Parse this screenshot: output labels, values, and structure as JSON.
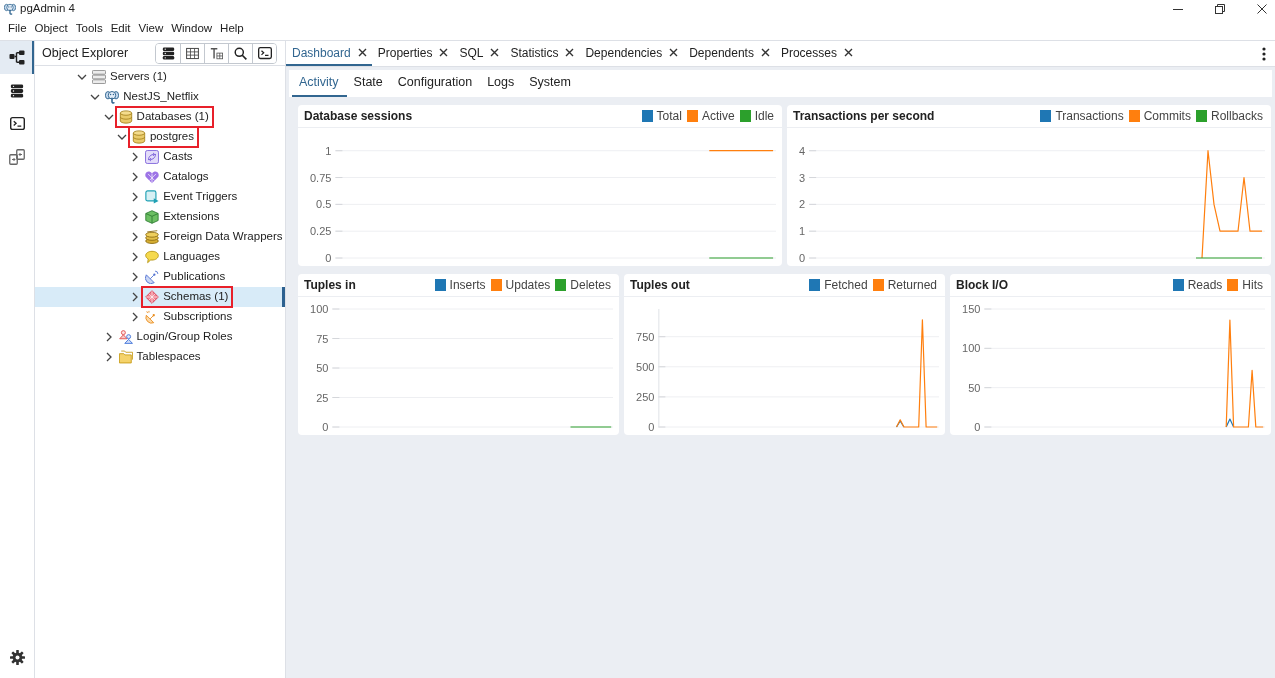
{
  "window": {
    "title": "pgAdmin 4"
  },
  "menu": [
    "File",
    "Object",
    "Tools",
    "Edit",
    "View",
    "Window",
    "Help"
  ],
  "activity_bar": [
    {
      "kind": "explorer",
      "selected": true
    },
    {
      "kind": "database",
      "selected": false
    },
    {
      "kind": "terminal",
      "selected": false
    },
    {
      "kind": "compare",
      "selected": false
    }
  ],
  "object_explorer": {
    "title": "Object Explorer",
    "tree": [
      {
        "label": "Servers (1)",
        "kind": "servers",
        "expanded": true,
        "selected": false,
        "outlined": false,
        "children": [
          {
            "label": "NestJS_Netflix",
            "kind": "server",
            "expanded": true,
            "selected": false,
            "outlined": false,
            "children": [
              {
                "label": "Databases (1)",
                "kind": "databases",
                "expanded": true,
                "selected": false,
                "outlined": true,
                "children": [
                  {
                    "label": "postgres",
                    "kind": "database",
                    "expanded": true,
                    "selected": false,
                    "outlined": true,
                    "children": [
                      {
                        "label": "Casts",
                        "kind": "casts",
                        "expanded": false,
                        "selected": false,
                        "outlined": false
                      },
                      {
                        "label": "Catalogs",
                        "kind": "catalogs",
                        "expanded": false,
                        "selected": false,
                        "outlined": false
                      },
                      {
                        "label": "Event Triggers",
                        "kind": "triggers",
                        "expanded": false,
                        "selected": false,
                        "outlined": false
                      },
                      {
                        "label": "Extensions",
                        "kind": "extensions",
                        "expanded": false,
                        "selected": false,
                        "outlined": false
                      },
                      {
                        "label": "Foreign Data Wrappers",
                        "kind": "wrappers",
                        "expanded": false,
                        "selected": false,
                        "outlined": false
                      },
                      {
                        "label": "Languages",
                        "kind": "languages",
                        "expanded": false,
                        "selected": false,
                        "outlined": false
                      },
                      {
                        "label": "Publications",
                        "kind": "publications",
                        "expanded": false,
                        "selected": false,
                        "outlined": false
                      },
                      {
                        "label": "Schemas (1)",
                        "kind": "schemas",
                        "expanded": false,
                        "selected": true,
                        "outlined": true
                      },
                      {
                        "label": "Subscriptions",
                        "kind": "subscriptions",
                        "expanded": false,
                        "selected": false,
                        "outlined": false
                      }
                    ]
                  }
                ]
              },
              {
                "label": "Login/Group Roles",
                "kind": "roles",
                "expanded": false,
                "selected": false,
                "outlined": false
              },
              {
                "label": "Tablespaces",
                "kind": "tablespaces",
                "expanded": false,
                "selected": false,
                "outlined": false
              }
            ]
          }
        ]
      }
    ]
  },
  "tabs": [
    {
      "label": "Dashboard",
      "selected": true
    },
    {
      "label": "Properties",
      "selected": false
    },
    {
      "label": "SQL",
      "selected": false
    },
    {
      "label": "Statistics",
      "selected": false
    },
    {
      "label": "Dependencies",
      "selected": false
    },
    {
      "label": "Dependents",
      "selected": false
    },
    {
      "label": "Processes",
      "selected": false
    }
  ],
  "subtabs": [
    {
      "label": "Activity",
      "selected": true
    },
    {
      "label": "State",
      "selected": false
    },
    {
      "label": "Configuration",
      "selected": false
    },
    {
      "label": "Logs",
      "selected": false
    },
    {
      "label": "System",
      "selected": false
    }
  ],
  "panel_rows": [
    [
      {
        "title": "Database sessions",
        "chart_data": {
          "type": "line",
          "grid": true,
          "categories": [
            null,
            null,
            null,
            null,
            null,
            null,
            null,
            null,
            null,
            null,
            null,
            null,
            null,
            null,
            null,
            null,
            null,
            null,
            null,
            null,
            null,
            null,
            null,
            null,
            null,
            null,
            null,
            null,
            null,
            null,
            null,
            null,
            null,
            null,
            null,
            null,
            null,
            null,
            null,
            null,
            null,
            null,
            null,
            null,
            null,
            null,
            null,
            null,
            null,
            null,
            null,
            null,
            null,
            null,
            null,
            null,
            null,
            null,
            null,
            null,
            null,
            null,
            null,
            null,
            null,
            null,
            null,
            null,
            null,
            null,
            null,
            null,
            null,
            null,
            null,
            null
          ],
          "ylim": [
            0,
            1
          ],
          "yticks": [
            0,
            0.25,
            0.5,
            0.75,
            1
          ],
          "series": [
            {
              "name": "Total",
              "color": "#1f77b4",
              "values": [
                null,
                null,
                null,
                null,
                null,
                null,
                null,
                null,
                null,
                null,
                null,
                null,
                null,
                null,
                null,
                null,
                null,
                null,
                null,
                null,
                null,
                null,
                null,
                null,
                null,
                null,
                null,
                null,
                null,
                null,
                null,
                null,
                null,
                null,
                null,
                null,
                null,
                null,
                null,
                null,
                null,
                null,
                null,
                null,
                null,
                null,
                null,
                null,
                null,
                null,
                null,
                null,
                null,
                null,
                null,
                null,
                null,
                null,
                null,
                null,
                null,
                null,
                null,
                null,
                null,
                null,
                null,
                null,
                null,
                null,
                null,
                null,
                null,
                null,
                null,
                null
              ]
            },
            {
              "name": "Active",
              "color": "#ff7f0e",
              "values": [
                null,
                null,
                null,
                null,
                null,
                null,
                null,
                null,
                null,
                null,
                null,
                null,
                null,
                null,
                null,
                null,
                null,
                null,
                null,
                null,
                null,
                null,
                null,
                null,
                null,
                null,
                null,
                null,
                null,
                null,
                null,
                null,
                null,
                null,
                null,
                null,
                null,
                null,
                null,
                null,
                null,
                null,
                null,
                null,
                null,
                null,
                null,
                null,
                null,
                null,
                null,
                null,
                null,
                null,
                null,
                null,
                null,
                null,
                null,
                null,
                null,
                null,
                null,
                null,
                1,
                1,
                1,
                1,
                1,
                1,
                1,
                1,
                1,
                1,
                1,
                1
              ]
            },
            {
              "name": "Idle",
              "color": "#2ca02c",
              "values": [
                null,
                null,
                null,
                null,
                null,
                null,
                null,
                null,
                null,
                null,
                null,
                null,
                null,
                null,
                null,
                null,
                null,
                null,
                null,
                null,
                null,
                null,
                null,
                null,
                null,
                null,
                null,
                null,
                null,
                null,
                null,
                null,
                null,
                null,
                null,
                null,
                null,
                null,
                null,
                null,
                null,
                null,
                null,
                null,
                null,
                null,
                null,
                null,
                null,
                null,
                null,
                null,
                null,
                null,
                null,
                null,
                null,
                null,
                null,
                null,
                null,
                null,
                null,
                null,
                0,
                0,
                0,
                0,
                0,
                0,
                0,
                0,
                0,
                0,
                0,
                0
              ]
            }
          ]
        }
      },
      {
        "title": "Transactions per second",
        "chart_data": {
          "type": "line",
          "grid": true,
          "categories": [
            null,
            null,
            null,
            null,
            null,
            null,
            null,
            null,
            null,
            null,
            null,
            null,
            null,
            null,
            null,
            null,
            null,
            null,
            null,
            null,
            null,
            null,
            null,
            null,
            null,
            null,
            null,
            null,
            null,
            null,
            null,
            null,
            null,
            null,
            null,
            null,
            null,
            null,
            null,
            null,
            null,
            null,
            null,
            null,
            null,
            null,
            null,
            null,
            null,
            null,
            null,
            null,
            null,
            null,
            null,
            null,
            null,
            null,
            null,
            null,
            null,
            null,
            null,
            null,
            null,
            null,
            null,
            null,
            null,
            null,
            null,
            null,
            null,
            null,
            null,
            null
          ],
          "ylim": [
            0,
            4
          ],
          "yticks": [
            0,
            1,
            2,
            3,
            4
          ],
          "series": [
            {
              "name": "Transactions",
              "color": "#1f77b4",
              "values": [
                null,
                null,
                null,
                null,
                null,
                null,
                null,
                null,
                null,
                null,
                null,
                null,
                null,
                null,
                null,
                null,
                null,
                null,
                null,
                null,
                null,
                null,
                null,
                null,
                null,
                null,
                null,
                null,
                null,
                null,
                null,
                null,
                null,
                null,
                null,
                null,
                null,
                null,
                null,
                null,
                null,
                null,
                null,
                null,
                null,
                null,
                null,
                null,
                null,
                null,
                null,
                null,
                null,
                null,
                null,
                null,
                null,
                null,
                null,
                null,
                null,
                null,
                null,
                null,
                null,
                null,
                null,
                null,
                null,
                null,
                null,
                null,
                null,
                null,
                null,
                null
              ]
            },
            {
              "name": "Commits",
              "color": "#ff7f0e",
              "values": [
                null,
                null,
                null,
                null,
                null,
                null,
                null,
                null,
                null,
                null,
                null,
                null,
                null,
                null,
                null,
                null,
                null,
                null,
                null,
                null,
                null,
                null,
                null,
                null,
                null,
                null,
                null,
                null,
                null,
                null,
                null,
                null,
                null,
                null,
                null,
                null,
                null,
                null,
                null,
                null,
                null,
                null,
                null,
                null,
                null,
                null,
                null,
                null,
                null,
                null,
                null,
                null,
                null,
                null,
                null,
                null,
                null,
                null,
                null,
                null,
                null,
                null,
                null,
                null,
                null,
                0,
                4,
                2,
                1,
                1,
                1,
                1,
                3,
                1,
                1,
                1
              ]
            },
            {
              "name": "Rollbacks",
              "color": "#2ca02c",
              "values": [
                null,
                null,
                null,
                null,
                null,
                null,
                null,
                null,
                null,
                null,
                null,
                null,
                null,
                null,
                null,
                null,
                null,
                null,
                null,
                null,
                null,
                null,
                null,
                null,
                null,
                null,
                null,
                null,
                null,
                null,
                null,
                null,
                null,
                null,
                null,
                null,
                null,
                null,
                null,
                null,
                null,
                null,
                null,
                null,
                null,
                null,
                null,
                null,
                null,
                null,
                null,
                null,
                null,
                null,
                null,
                null,
                null,
                null,
                null,
                null,
                null,
                null,
                null,
                null,
                0,
                0,
                0,
                0,
                0,
                0,
                0,
                0,
                0,
                0,
                0,
                0
              ]
            }
          ]
        }
      }
    ],
    [
      {
        "title": "Tuples in",
        "chart_data": {
          "type": "line",
          "grid": true,
          "categories": [
            null,
            null,
            null,
            null,
            null,
            null,
            null,
            null,
            null,
            null,
            null,
            null,
            null,
            null,
            null,
            null,
            null,
            null,
            null,
            null,
            null,
            null,
            null,
            null,
            null,
            null,
            null,
            null,
            null,
            null,
            null,
            null,
            null,
            null,
            null,
            null,
            null,
            null,
            null,
            null,
            null,
            null,
            null,
            null,
            null,
            null,
            null,
            null,
            null,
            null,
            null,
            null,
            null,
            null,
            null,
            null,
            null,
            null,
            null,
            null,
            null,
            null,
            null,
            null,
            null,
            null,
            null,
            null,
            null,
            null,
            null,
            null,
            null,
            null,
            null,
            null
          ],
          "ylim": [
            0,
            100
          ],
          "yticks": [
            0,
            25,
            50,
            75,
            100
          ],
          "series": [
            {
              "name": "Inserts",
              "color": "#1f77b4",
              "values": [
                null,
                null,
                null,
                null,
                null,
                null,
                null,
                null,
                null,
                null,
                null,
                null,
                null,
                null,
                null,
                null,
                null,
                null,
                null,
                null,
                null,
                null,
                null,
                null,
                null,
                null,
                null,
                null,
                null,
                null,
                null,
                null,
                null,
                null,
                null,
                null,
                null,
                null,
                null,
                null,
                null,
                null,
                null,
                null,
                null,
                null,
                null,
                null,
                null,
                null,
                null,
                null,
                null,
                null,
                null,
                null,
                null,
                null,
                null,
                null,
                null,
                null,
                null,
                null,
                null,
                null,
                null,
                null,
                null,
                null,
                null,
                null,
                null,
                null,
                null,
                null
              ]
            },
            {
              "name": "Updates",
              "color": "#ff7f0e",
              "values": [
                null,
                null,
                null,
                null,
                null,
                null,
                null,
                null,
                null,
                null,
                null,
                null,
                null,
                null,
                null,
                null,
                null,
                null,
                null,
                null,
                null,
                null,
                null,
                null,
                null,
                null,
                null,
                null,
                null,
                null,
                null,
                null,
                null,
                null,
                null,
                null,
                null,
                null,
                null,
                null,
                null,
                null,
                null,
                null,
                null,
                null,
                null,
                null,
                null,
                null,
                null,
                null,
                null,
                null,
                null,
                null,
                null,
                null,
                null,
                null,
                null,
                null,
                null,
                null,
                null,
                null,
                null,
                null,
                null,
                null,
                null,
                null,
                null,
                null,
                null,
                null
              ]
            },
            {
              "name": "Deletes",
              "color": "#2ca02c",
              "values": [
                null,
                null,
                null,
                null,
                null,
                null,
                null,
                null,
                null,
                null,
                null,
                null,
                null,
                null,
                null,
                null,
                null,
                null,
                null,
                null,
                null,
                null,
                null,
                null,
                null,
                null,
                null,
                null,
                null,
                null,
                null,
                null,
                null,
                null,
                null,
                null,
                null,
                null,
                null,
                null,
                null,
                null,
                null,
                null,
                null,
                null,
                null,
                null,
                null,
                null,
                null,
                null,
                null,
                null,
                null,
                null,
                null,
                null,
                null,
                null,
                null,
                null,
                null,
                null,
                0,
                0,
                0,
                0,
                0,
                0,
                0,
                0,
                0,
                0,
                0,
                0
              ]
            }
          ]
        }
      },
      {
        "title": "Tuples out",
        "chart_data": {
          "type": "line",
          "grid": true,
          "categories": [
            null,
            null,
            null,
            null,
            null,
            null,
            null,
            null,
            null,
            null,
            null,
            null,
            null,
            null,
            null,
            null,
            null,
            null,
            null,
            null,
            null,
            null,
            null,
            null,
            null,
            null,
            null,
            null,
            null,
            null,
            null,
            null,
            null,
            null,
            null,
            null,
            null,
            null,
            null,
            null,
            null,
            null,
            null,
            null,
            null,
            null,
            null,
            null,
            null,
            null,
            null,
            null,
            null,
            null,
            null,
            null,
            null,
            null,
            null,
            null,
            null,
            null,
            null,
            null,
            null,
            null,
            null,
            null,
            null,
            null,
            null,
            null,
            null,
            null,
            null,
            null
          ],
          "ylim": [
            0,
            980
          ],
          "yticks": [
            0,
            250,
            500,
            750
          ],
          "series": [
            {
              "name": "Fetched",
              "color": "#1f77b4",
              "values": [
                null,
                null,
                null,
                null,
                null,
                null,
                null,
                null,
                null,
                null,
                null,
                null,
                null,
                null,
                null,
                null,
                null,
                null,
                null,
                null,
                null,
                null,
                null,
                null,
                null,
                null,
                null,
                null,
                null,
                null,
                null,
                null,
                null,
                null,
                null,
                null,
                null,
                null,
                null,
                null,
                null,
                null,
                null,
                null,
                null,
                null,
                null,
                null,
                null,
                null,
                null,
                null,
                null,
                null,
                null,
                null,
                null,
                null,
                null,
                null,
                null,
                null,
                null,
                null,
                0,
                50,
                0,
                null,
                null,
                null,
                null,
                null,
                null,
                null,
                null,
                null
              ]
            },
            {
              "name": "Returned",
              "color": "#ff7f0e",
              "values": [
                null,
                null,
                null,
                null,
                null,
                null,
                null,
                null,
                null,
                null,
                null,
                null,
                null,
                null,
                null,
                null,
                null,
                null,
                null,
                null,
                null,
                null,
                null,
                null,
                null,
                null,
                null,
                null,
                null,
                null,
                null,
                null,
                null,
                null,
                null,
                null,
                null,
                null,
                null,
                null,
                null,
                null,
                null,
                null,
                null,
                null,
                null,
                null,
                null,
                null,
                null,
                null,
                null,
                null,
                null,
                null,
                null,
                null,
                null,
                null,
                null,
                null,
                null,
                null,
                0,
                60,
                0,
                0,
                0,
                0,
                0,
                890,
                0,
                0,
                0,
                0
              ]
            }
          ]
        }
      },
      {
        "title": "Block I/O",
        "chart_data": {
          "type": "line",
          "grid": true,
          "categories": [
            null,
            null,
            null,
            null,
            null,
            null,
            null,
            null,
            null,
            null,
            null,
            null,
            null,
            null,
            null,
            null,
            null,
            null,
            null,
            null,
            null,
            null,
            null,
            null,
            null,
            null,
            null,
            null,
            null,
            null,
            null,
            null,
            null,
            null,
            null,
            null,
            null,
            null,
            null,
            null,
            null,
            null,
            null,
            null,
            null,
            null,
            null,
            null,
            null,
            null,
            null,
            null,
            null,
            null,
            null,
            null,
            null,
            null,
            null,
            null,
            null,
            null,
            null,
            null,
            null,
            null,
            null,
            null,
            null,
            null,
            null,
            null,
            null,
            null,
            null,
            null
          ],
          "ylim": [
            0,
            150
          ],
          "yticks": [
            0,
            50,
            100,
            150
          ],
          "series": [
            {
              "name": "Reads",
              "color": "#1f77b4",
              "values": [
                null,
                null,
                null,
                null,
                null,
                null,
                null,
                null,
                null,
                null,
                null,
                null,
                null,
                null,
                null,
                null,
                null,
                null,
                null,
                null,
                null,
                null,
                null,
                null,
                null,
                null,
                null,
                null,
                null,
                null,
                null,
                null,
                null,
                null,
                null,
                null,
                null,
                null,
                null,
                null,
                null,
                null,
                null,
                null,
                null,
                null,
                null,
                null,
                null,
                null,
                null,
                null,
                null,
                null,
                null,
                null,
                null,
                null,
                null,
                null,
                null,
                null,
                null,
                null,
                null,
                0,
                10,
                0,
                null,
                null,
                null,
                null,
                null,
                null,
                null,
                null
              ]
            },
            {
              "name": "Hits",
              "color": "#ff7f0e",
              "values": [
                null,
                null,
                null,
                null,
                null,
                null,
                null,
                null,
                null,
                null,
                null,
                null,
                null,
                null,
                null,
                null,
                null,
                null,
                null,
                null,
                null,
                null,
                null,
                null,
                null,
                null,
                null,
                null,
                null,
                null,
                null,
                null,
                null,
                null,
                null,
                null,
                null,
                null,
                null,
                null,
                null,
                null,
                null,
                null,
                null,
                null,
                null,
                null,
                null,
                null,
                null,
                null,
                null,
                null,
                null,
                null,
                null,
                null,
                null,
                null,
                null,
                null,
                null,
                null,
                null,
                0,
                136,
                0,
                0,
                0,
                0,
                0,
                72,
                0,
                0,
                0
              ]
            }
          ]
        }
      }
    ]
  ]
}
